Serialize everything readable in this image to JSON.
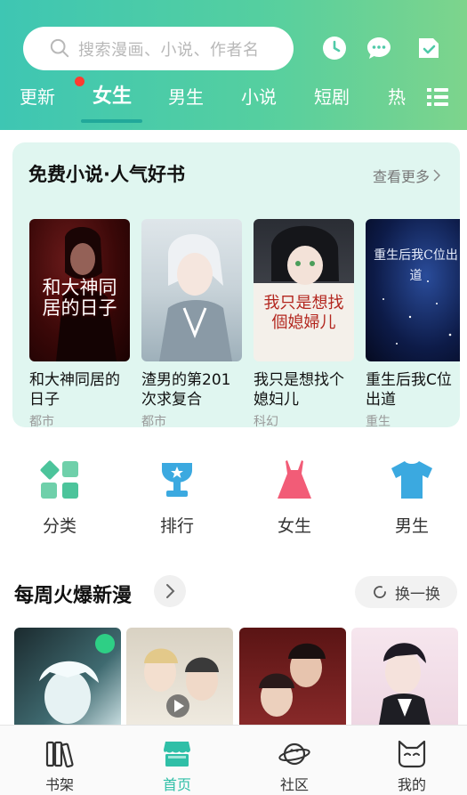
{
  "header": {
    "search_placeholder": "搜索漫画、小说、作者名",
    "icons": [
      "search-icon",
      "history-clock-icon",
      "message-icon",
      "checkin-icon"
    ],
    "tabs": [
      "更新",
      "女生",
      "男生",
      "小说",
      "短剧",
      "热"
    ],
    "active_tab": "女生"
  },
  "free_section": {
    "title": "免费小说·人气好书",
    "more_label": "查看更多",
    "books": [
      {
        "title": "和大神同居的日子",
        "tag": "都市",
        "cover_text": "和大神同居的日子"
      },
      {
        "title": "渣男的第201次求复合",
        "tag": "都市"
      },
      {
        "title": "我只是想找个媳妇儿",
        "tag": "科幻",
        "cover_text": "我只是想找個媳婦儿"
      },
      {
        "title": "重生后我C位出道",
        "tag": "重生",
        "cover_text": "重生后我C位出道"
      }
    ]
  },
  "categories": [
    {
      "label": "分类",
      "icon": "category-grid-icon"
    },
    {
      "label": "排行",
      "icon": "trophy-icon"
    },
    {
      "label": "女生",
      "icon": "dress-icon"
    },
    {
      "label": "男生",
      "icon": "tshirt-icon"
    }
  ],
  "weekly": {
    "title": "每周火爆新漫",
    "refresh_label": "换一换"
  },
  "bottom_nav": {
    "items": [
      {
        "label": "书架",
        "icon": "bookshelf-icon"
      },
      {
        "label": "首页",
        "icon": "home-store-icon"
      },
      {
        "label": "社区",
        "icon": "planet-icon"
      },
      {
        "label": "我的",
        "icon": "cat-face-icon"
      }
    ],
    "active": "首页"
  },
  "colors": {
    "accent": "#2fbfa7",
    "header_gradient_start": "#3ec6b3",
    "header_gradient_end": "#7dd48c",
    "card_bg": "#e0f6f0",
    "badge_red": "#ff3b30"
  }
}
